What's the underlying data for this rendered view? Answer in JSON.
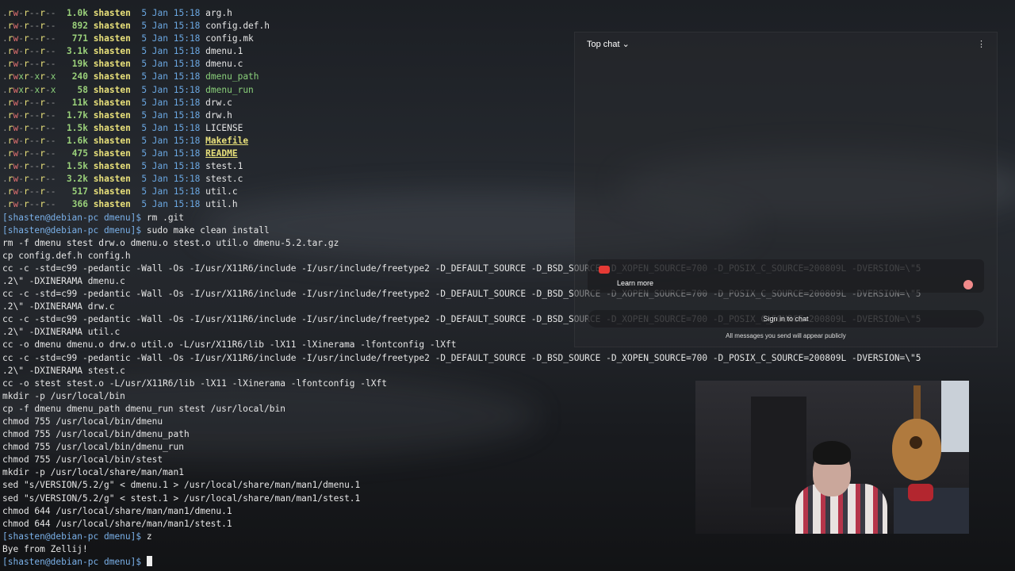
{
  "listing": [
    {
      "perm": ".rw-r--r--",
      "size": "1.0k",
      "user": "shasten",
      "date": "5 Jan 15:18",
      "name": "arg.h",
      "kind": "file"
    },
    {
      "perm": ".rw-r--r--",
      "size": "892",
      "user": "shasten",
      "date": "5 Jan 15:18",
      "name": "config.def.h",
      "kind": "file"
    },
    {
      "perm": ".rw-r--r--",
      "size": "771",
      "user": "shasten",
      "date": "5 Jan 15:18",
      "name": "config.mk",
      "kind": "file"
    },
    {
      "perm": ".rw-r--r--",
      "size": "3.1k",
      "user": "shasten",
      "date": "5 Jan 15:18",
      "name": "dmenu.1",
      "kind": "file"
    },
    {
      "perm": ".rw-r--r--",
      "size": "19k",
      "user": "shasten",
      "date": "5 Jan 15:18",
      "name": "dmenu.c",
      "kind": "file"
    },
    {
      "perm": ".rwxr-xr-x",
      "size": "240",
      "user": "shasten",
      "date": "5 Jan 15:18",
      "name": "dmenu_path",
      "kind": "exec"
    },
    {
      "perm": ".rwxr-xr-x",
      "size": "58",
      "user": "shasten",
      "date": "5 Jan 15:18",
      "name": "dmenu_run",
      "kind": "exec"
    },
    {
      "perm": ".rw-r--r--",
      "size": "11k",
      "user": "shasten",
      "date": "5 Jan 15:18",
      "name": "drw.c",
      "kind": "file"
    },
    {
      "perm": ".rw-r--r--",
      "size": "1.7k",
      "user": "shasten",
      "date": "5 Jan 15:18",
      "name": "drw.h",
      "kind": "file"
    },
    {
      "perm": ".rw-r--r--",
      "size": "1.5k",
      "user": "shasten",
      "date": "5 Jan 15:18",
      "name": "LICENSE",
      "kind": "file"
    },
    {
      "perm": ".rw-r--r--",
      "size": "1.6k",
      "user": "shasten",
      "date": "5 Jan 15:18",
      "name": "Makefile",
      "kind": "special"
    },
    {
      "perm": ".rw-r--r--",
      "size": "475",
      "user": "shasten",
      "date": "5 Jan 15:18",
      "name": "README",
      "kind": "special"
    },
    {
      "perm": ".rw-r--r--",
      "size": "1.5k",
      "user": "shasten",
      "date": "5 Jan 15:18",
      "name": "stest.1",
      "kind": "file"
    },
    {
      "perm": ".rw-r--r--",
      "size": "3.2k",
      "user": "shasten",
      "date": "5 Jan 15:18",
      "name": "stest.c",
      "kind": "file"
    },
    {
      "perm": ".rw-r--r--",
      "size": "517",
      "user": "shasten",
      "date": "5 Jan 15:18",
      "name": "util.c",
      "kind": "file"
    },
    {
      "perm": ".rw-r--r--",
      "size": "366",
      "user": "shasten",
      "date": "5 Jan 15:18",
      "name": "util.h",
      "kind": "file"
    }
  ],
  "prompt": "[shasten@debian-pc dmenu]$",
  "commands": {
    "rm_git": "rm .git",
    "make": "sudo make clean install",
    "z": "z"
  },
  "make_output": [
    "rm -f dmenu stest drw.o dmenu.o stest.o util.o dmenu-5.2.tar.gz",
    "cp config.def.h config.h",
    "cc -c -std=c99 -pedantic -Wall -Os -I/usr/X11R6/include -I/usr/include/freetype2 -D_DEFAULT_SOURCE -D_BSD_SOURCE -D_XOPEN_SOURCE=700 -D_POSIX_C_SOURCE=200809L -DVERSION=\\\"5",
    ".2\\\" -DXINERAMA dmenu.c",
    "cc -c -std=c99 -pedantic -Wall -Os -I/usr/X11R6/include -I/usr/include/freetype2 -D_DEFAULT_SOURCE -D_BSD_SOURCE -D_XOPEN_SOURCE=700 -D_POSIX_C_SOURCE=200809L -DVERSION=\\\"5",
    ".2\\\" -DXINERAMA drw.c",
    "cc -c -std=c99 -pedantic -Wall -Os -I/usr/X11R6/include -I/usr/include/freetype2 -D_DEFAULT_SOURCE -D_BSD_SOURCE -D_XOPEN_SOURCE=700 -D_POSIX_C_SOURCE=200809L -DVERSION=\\\"5",
    ".2\\\" -DXINERAMA util.c",
    "cc -o dmenu dmenu.o drw.o util.o -L/usr/X11R6/lib -lX11 -lXinerama -lfontconfig -lXft",
    "cc -c -std=c99 -pedantic -Wall -Os -I/usr/X11R6/include -I/usr/include/freetype2 -D_DEFAULT_SOURCE -D_BSD_SOURCE -D_XOPEN_SOURCE=700 -D_POSIX_C_SOURCE=200809L -DVERSION=\\\"5",
    ".2\\\" -DXINERAMA stest.c",
    "cc -o stest stest.o -L/usr/X11R6/lib -lX11 -lXinerama -lfontconfig -lXft",
    "mkdir -p /usr/local/bin",
    "cp -f dmenu dmenu_path dmenu_run stest /usr/local/bin",
    "chmod 755 /usr/local/bin/dmenu",
    "chmod 755 /usr/local/bin/dmenu_path",
    "chmod 755 /usr/local/bin/dmenu_run",
    "chmod 755 /usr/local/bin/stest",
    "mkdir -p /usr/local/share/man/man1",
    "sed \"s/VERSION/5.2/g\" < dmenu.1 > /usr/local/share/man/man1/dmenu.1",
    "sed \"s/VERSION/5.2/g\" < stest.1 > /usr/local/share/man/man1/stest.1",
    "chmod 644 /usr/local/share/man/man1/dmenu.1",
    "chmod 644 /usr/local/share/man/man1/stest.1"
  ],
  "exit_message": "Bye from Zellij!",
  "chat": {
    "header": "Top chat ⌄",
    "menu_icon": "more-vert-icon",
    "learn_more": "Learn more",
    "sign_in": "Sign in to chat",
    "public_notice": "All messages you send will appear publicly"
  },
  "colors": {
    "prompt": "#7ab0e8",
    "size": "#9ad07a",
    "user": "#e8e07a",
    "date": "#6aa6e0"
  }
}
